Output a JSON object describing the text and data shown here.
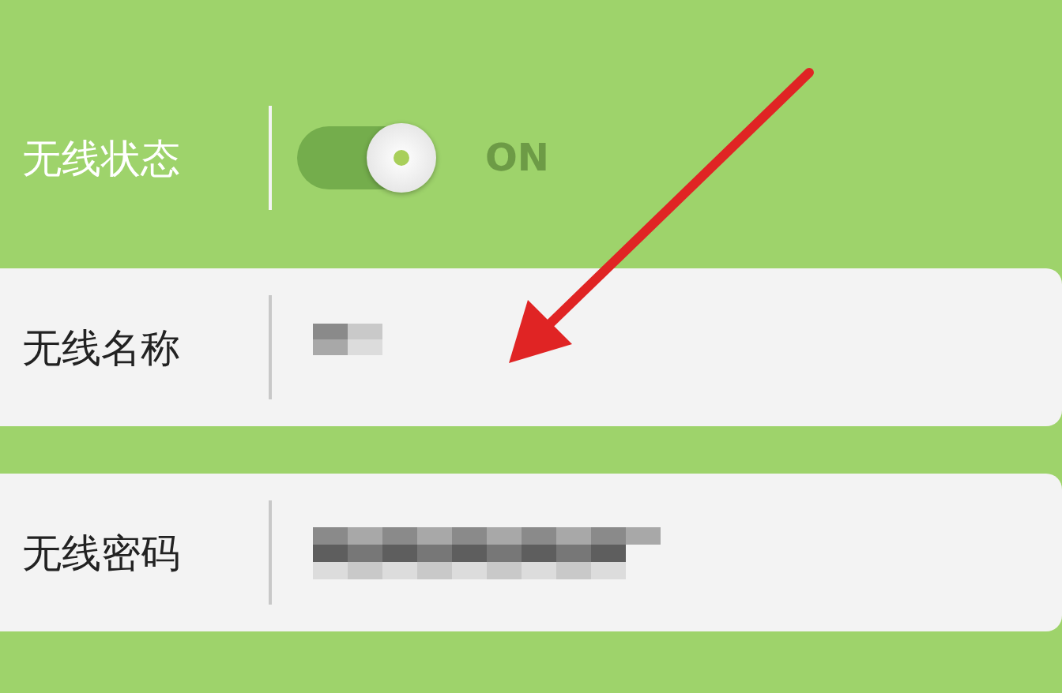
{
  "wireless_status": {
    "label": "无线状态",
    "on": true,
    "state_text": "ON"
  },
  "fields": [
    {
      "label": "无线名称",
      "masked": true
    },
    {
      "label": "无线密码",
      "masked": true
    }
  ]
}
